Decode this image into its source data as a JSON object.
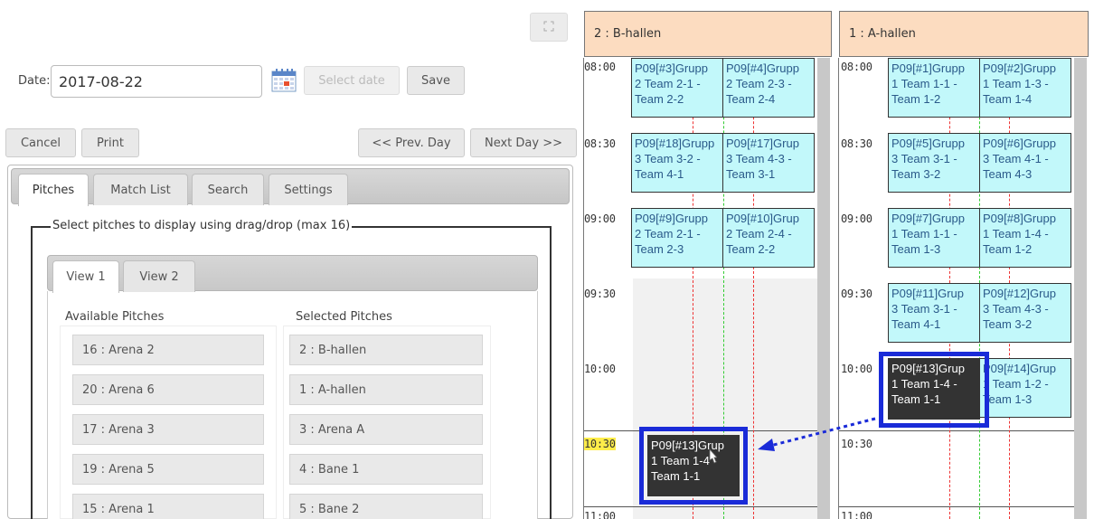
{
  "toolbar": {
    "expand_icon": "expand-icon",
    "date_label": "Date:",
    "date_value": "2017-08-22",
    "select_date": "Select date",
    "save": "Save",
    "cancel": "Cancel",
    "print": "Print",
    "prev_day": "<< Prev. Day",
    "next_day": "Next Day >>"
  },
  "tabs": [
    "Pitches",
    "Match List",
    "Search",
    "Settings"
  ],
  "pitch_selector": {
    "legend": "Select pitches to display using drag/drop (max 16)",
    "views": [
      "View 1",
      "View 2"
    ],
    "available_header": "Available Pitches",
    "selected_header": "Selected Pitches",
    "available": [
      "16 : Arena 2",
      "20 : Arena 6",
      "17 : Arena 3",
      "19 : Arena 5",
      "15 : Arena 1"
    ],
    "selected": [
      "2 : B-hallen",
      "1 : A-hallen",
      "3 : Arena A",
      "4 : Bane 1",
      "5 : Bane 2"
    ]
  },
  "schedule": {
    "pitches": [
      "2 : B-hallen",
      "1 : A-hallen"
    ],
    "times": [
      "08:00",
      "08:30",
      "09:00",
      "09:30",
      "10:00",
      "10:30",
      "11:00"
    ],
    "current_time": "10:30",
    "b_hallen": [
      {
        "l1": "P09[#3]Grupp",
        "l2": "2 Team 2-1 -",
        "l3": "Team 2-2"
      },
      {
        "l1": "P09[#4]Grupp",
        "l2": "2 Team 2-3 -",
        "l3": "Team 2-4"
      },
      {
        "l1": "P09[#18]Grupp",
        "l2": "3 Team 3-2 -",
        "l3": "Team 4-1"
      },
      {
        "l1": "P09[#17]Grup",
        "l2": "3 Team 4-3 -",
        "l3": "Team 3-1"
      },
      {
        "l1": "P09[#9]Grupp",
        "l2": "2 Team 2-1 -",
        "l3": "Team 2-3"
      },
      {
        "l1": "P09[#10]Grup",
        "l2": "2 Team 2-4 -",
        "l3": "Team 2-2"
      }
    ],
    "a_hallen": [
      {
        "l1": "P09[#1]Grupp",
        "l2": "1 Team 1-1 -",
        "l3": "Team 1-2"
      },
      {
        "l1": "P09[#2]Grupp",
        "l2": "1 Team 1-3 -",
        "l3": "Team 1-4"
      },
      {
        "l1": "P09[#5]Grupp",
        "l2": "3 Team 3-1 -",
        "l3": "Team 3-2"
      },
      {
        "l1": "P09[#6]Grupp",
        "l2": "3 Team 4-1 -",
        "l3": "Team 4-3"
      },
      {
        "l1": "P09[#7]Grupp",
        "l2": "1 Team 1-1 -",
        "l3": "Team 1-3"
      },
      {
        "l1": "P09[#8]Grupp",
        "l2": "1 Team 1-4 -",
        "l3": "Team 1-2"
      },
      {
        "l1": "P09[#11]Grup",
        "l2": "3 Team 3-1 -",
        "l3": "Team 4-1"
      },
      {
        "l1": "P09[#12]Grup",
        "l2": "3 Team 4-3 -",
        "l3": "Team 3-2"
      },
      {
        "l1": "P09[#13]Grup",
        "l2": "1 Team 1-4 -",
        "l3": "Team 1-1"
      },
      {
        "l1": "P09[#14]Grup",
        "l2": "1 Team 1-2 -",
        "l3": "Team 1-3"
      }
    ],
    "dragged": {
      "l1": "P09[#13]Grup",
      "l2": "1 Team 1-4 -",
      "l3": "Team 1-1"
    }
  },
  "colors": {
    "match_bg": "#c2f8fa",
    "header_bg": "#fcdcc0",
    "highlight": "#1a2bd8",
    "current_time": "#ffed4a"
  }
}
